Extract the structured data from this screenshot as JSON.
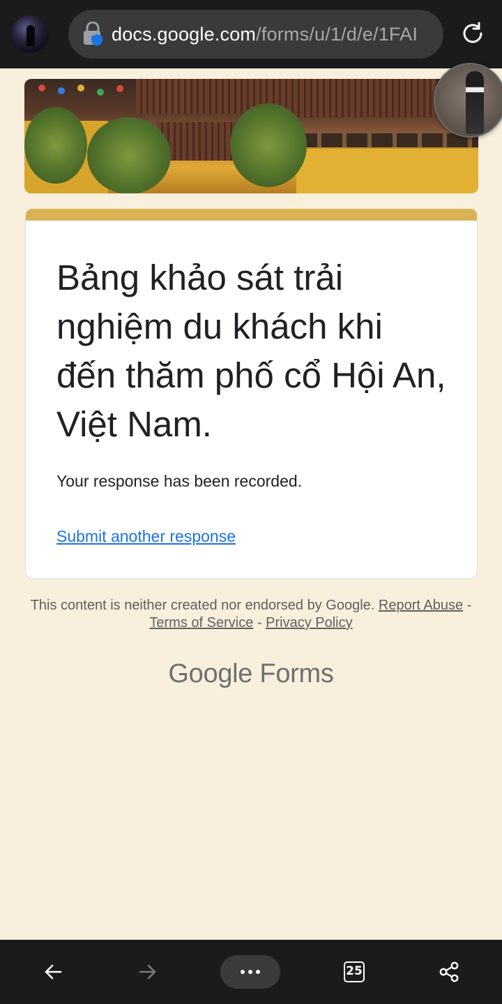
{
  "browser": {
    "url_host": "docs.google.com",
    "url_path": "/forms/u/1/d/e/1FAI",
    "tab_count": "25",
    "icons": {
      "lock": "lock-shield-icon",
      "reload": "reload-icon",
      "back": "back-arrow-icon",
      "forward": "forward-arrow-icon",
      "menu": "more-dots-icon",
      "tabs": "tabs-icon",
      "share": "share-icon"
    }
  },
  "form": {
    "title": "Bảng khảo sát trải nghiệm du khách khi đến thăm phố cổ Hội An, Việt Nam.",
    "status": "Your response has been recorded.",
    "submit_another": "Submit another response",
    "accent_color": "#dbb253"
  },
  "footer": {
    "disclaimer": "This content is neither created nor endorsed by Google.",
    "report_abuse": "Report Abuse",
    "separator": "-",
    "terms": "Terms of Service",
    "privacy": "Privacy Policy",
    "brand_google": "Google",
    "brand_forms": "Forms"
  },
  "colors": {
    "page_background": "#f8efdd",
    "link": "#1a73e8",
    "browser_chrome": "#1b1b1b"
  }
}
